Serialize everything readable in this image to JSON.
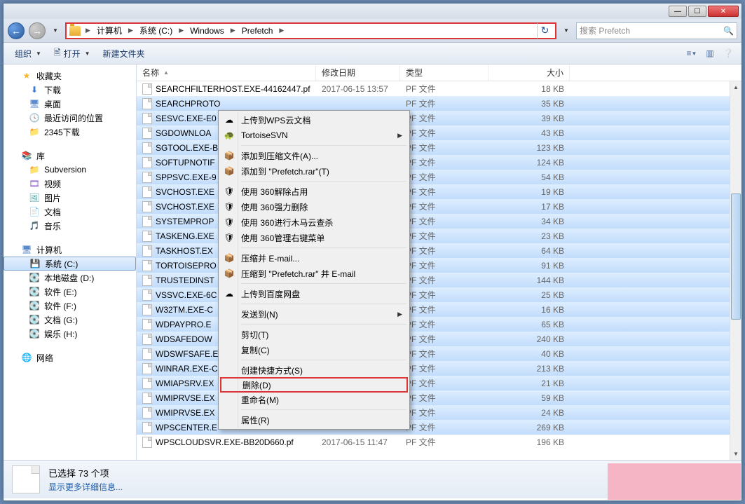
{
  "titlebar": {
    "min": "—",
    "max": "☐",
    "close": "✕"
  },
  "addressbar": {
    "crumbs": [
      "计算机",
      "系统 (C:)",
      "Windows",
      "Prefetch"
    ],
    "search_placeholder": "搜索 Prefetch"
  },
  "toolbar": {
    "organize": "组织",
    "open": "打开",
    "newfolder": "新建文件夹"
  },
  "sidebar": {
    "favorites": {
      "label": "收藏夹",
      "items": [
        "下载",
        "桌面",
        "最近访问的位置",
        "2345下载"
      ]
    },
    "libraries": {
      "label": "库",
      "items": [
        "Subversion",
        "视频",
        "图片",
        "文档",
        "音乐"
      ]
    },
    "computer": {
      "label": "计算机",
      "items": [
        "系统 (C:)",
        "本地磁盘 (D:)",
        "软件 (E:)",
        "软件 (F:)",
        "文档 (G:)",
        "娱乐 (H:)"
      ]
    },
    "network": {
      "label": "网络"
    }
  },
  "columns": {
    "name": "名称",
    "date": "修改日期",
    "type": "类型",
    "size": "大小"
  },
  "files": [
    {
      "name": "SEARCHFILTERHOST.EXE-44162447.pf",
      "date": "2017-06-15 13:57",
      "type": "PF 文件",
      "size": "18 KB"
    },
    {
      "name": "SEARCHPROTO",
      "date": "",
      "type": "PF 文件",
      "size": "35 KB"
    },
    {
      "name": "SESVC.EXE-E0",
      "date": "",
      "type": "PF 文件",
      "size": "39 KB"
    },
    {
      "name": "SGDOWNLOA",
      "date": "",
      "type": "PF 文件",
      "size": "43 KB"
    },
    {
      "name": "SGTOOL.EXE-B",
      "date": "",
      "type": "PF 文件",
      "size": "123 KB"
    },
    {
      "name": "SOFTUPNOTIF",
      "date": "",
      "type": "PF 文件",
      "size": "124 KB"
    },
    {
      "name": "SPPSVC.EXE-9",
      "date": "",
      "type": "PF 文件",
      "size": "54 KB"
    },
    {
      "name": "SVCHOST.EXE",
      "date": "",
      "type": "PF 文件",
      "size": "19 KB"
    },
    {
      "name": "SVCHOST.EXE",
      "date": "",
      "type": "PF 文件",
      "size": "17 KB"
    },
    {
      "name": "SYSTEMPROP",
      "date": "",
      "type": "PF 文件",
      "size": "34 KB"
    },
    {
      "name": "TASKENG.EXE",
      "date": "",
      "type": "PF 文件",
      "size": "23 KB"
    },
    {
      "name": "TASKHOST.EX",
      "date": "",
      "type": "PF 文件",
      "size": "64 KB"
    },
    {
      "name": "TORTOISEPRO",
      "date": "",
      "type": "PF 文件",
      "size": "91 KB"
    },
    {
      "name": "TRUSTEDINST",
      "date": "",
      "type": "PF 文件",
      "size": "144 KB"
    },
    {
      "name": "VSSVC.EXE-6C",
      "date": "",
      "type": "PF 文件",
      "size": "25 KB"
    },
    {
      "name": "W32TM.EXE-C",
      "date": "",
      "type": "PF 文件",
      "size": "16 KB"
    },
    {
      "name": "WDPAYPRO.E",
      "date": "",
      "type": "PF 文件",
      "size": "65 KB"
    },
    {
      "name": "WDSAFEDOW",
      "date": "",
      "type": "PF 文件",
      "size": "240 KB"
    },
    {
      "name": "WDSWFSAFE.E",
      "date": "",
      "type": "PF 文件",
      "size": "40 KB"
    },
    {
      "name": "WINRAR.EXE-C",
      "date": "",
      "type": "PF 文件",
      "size": "213 KB"
    },
    {
      "name": "WMIAPSRV.EX",
      "date": "",
      "type": "PF 文件",
      "size": "21 KB"
    },
    {
      "name": "WMIPRVSE.EX",
      "date": "",
      "type": "PF 文件",
      "size": "59 KB"
    },
    {
      "name": "WMIPRVSE.EX",
      "date": "",
      "type": "PF 文件",
      "size": "24 KB"
    },
    {
      "name": "WPSCENTER.E",
      "date": "",
      "type": "PF 文件",
      "size": "269 KB"
    },
    {
      "name": "WPSCLOUDSVR.EXE-BB20D660.pf",
      "date": "2017-06-15 11:47",
      "type": "PF 文件",
      "size": "196 KB"
    }
  ],
  "contextmenu": {
    "items": [
      {
        "icon": "☁",
        "label": "上传到WPS云文档"
      },
      {
        "icon": "🐢",
        "label": "TortoiseSVN",
        "submenu": true
      },
      {
        "sep": true
      },
      {
        "icon": "📦",
        "label": "添加到压缩文件(A)..."
      },
      {
        "icon": "📦",
        "label": "添加到 \"Prefetch.rar\"(T)"
      },
      {
        "sep": true
      },
      {
        "icon": "🛡",
        "label": "使用 360解除占用"
      },
      {
        "icon": "🛡",
        "label": "使用 360强力删除"
      },
      {
        "icon": "🛡",
        "label": "使用 360进行木马云查杀"
      },
      {
        "icon": "🛡",
        "label": "使用 360管理右键菜单"
      },
      {
        "sep": true
      },
      {
        "icon": "📦",
        "label": "压缩并 E-mail..."
      },
      {
        "icon": "📦",
        "label": "压缩到 \"Prefetch.rar\" 并 E-mail"
      },
      {
        "sep": true
      },
      {
        "icon": "☁",
        "label": "上传到百度网盘"
      },
      {
        "sep": true
      },
      {
        "icon": "",
        "label": "发送到(N)",
        "submenu": true
      },
      {
        "sep": true
      },
      {
        "icon": "",
        "label": "剪切(T)"
      },
      {
        "icon": "",
        "label": "复制(C)"
      },
      {
        "sep": true
      },
      {
        "icon": "",
        "label": "创建快捷方式(S)"
      },
      {
        "icon": "",
        "label": "删除(D)",
        "highlighted": true
      },
      {
        "icon": "",
        "label": "重命名(M)"
      },
      {
        "sep": true
      },
      {
        "icon": "",
        "label": "属性(R)"
      }
    ]
  },
  "status": {
    "line1": "已选择 73 个项",
    "line2": "显示更多详细信息..."
  }
}
